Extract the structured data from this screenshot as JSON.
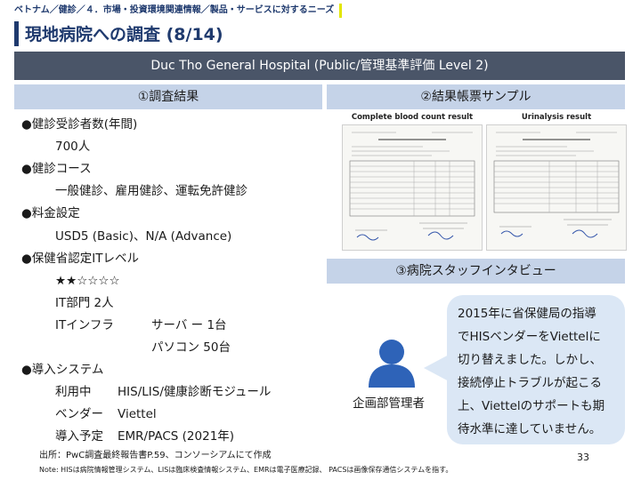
{
  "header": {
    "breadcrumb": "ベトナム／健診／４．市場・投資環境関連情報／製品・サービスに対するニーズ",
    "title": "現地病院への調査 (8/14)"
  },
  "hospital": {
    "name": "Duc Tho General Hospital (Public/管理基準評価 Level 2)"
  },
  "sections": {
    "results": "①調査結果",
    "sample": "②結果帳票サンプル",
    "interview": "③病院スタッフインタビュー"
  },
  "results": {
    "patients_label": "●健診受診者数(年間)",
    "patients_value": "700人",
    "course_label": "●健診コース",
    "course_value": "一般健診、雇用健診、運転免許健診",
    "fee_label": "●料金設定",
    "fee_value": "USD5 (Basic)、N/A (Advance)",
    "it_label": "●保健省認定ITレベル",
    "it_stars": "★★☆☆☆☆",
    "it_dept": "IT部門 2人",
    "it_infra_label": "ITインフラ",
    "it_server": "サーバ ー 1台",
    "it_pc": "パソコン 50台",
    "system_label": "●導入システム",
    "in_use_label": "利用中",
    "in_use_value": "HIS/LIS/健康診断モジュール",
    "vendor_label": "ベンダー",
    "vendor_value": "Viettel",
    "planned_label": "導入予定",
    "planned_value": "EMR/PACS (2021年)"
  },
  "samples": {
    "blood_title": "Complete blood count result",
    "urine_title": "Urinalysis result"
  },
  "interview": {
    "role": "企画部管理者",
    "quote_lines": [
      "2015年に省保健局の指導",
      "でHISベンダーをViettelに",
      "切り替えました。しかし、",
      "接続停止トラブルが起こる",
      "上、Viettelのサポートも期",
      "待水準に達していません。"
    ]
  },
  "footer": {
    "source": "出所：PwC調査最終報告書P.59、コンソーシアムにて作成",
    "note": "Note: HISは病院情報管理システム、LISは臨床検査情報システム、EMRは電子医療記録、 PACSは画像保存通信システムを指す。",
    "page": "33"
  },
  "colors": {
    "navy": "#1f3a6e",
    "section": "#c5d3e8",
    "bar": "#4a5568",
    "bubble": "#dbe7f5",
    "accent": "#e2e600"
  }
}
